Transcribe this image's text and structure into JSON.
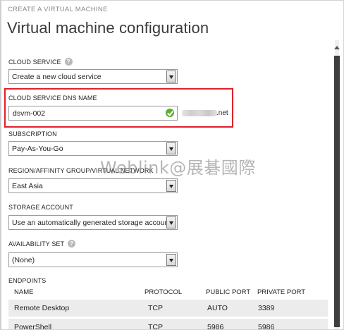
{
  "breadcrumb": "CREATE A VIRTUAL MACHINE",
  "page_title": "Virtual machine configuration",
  "cloud_service": {
    "label": "CLOUD SERVICE",
    "value": "Create a new cloud service"
  },
  "dns_name": {
    "label": "CLOUD SERVICE DNS NAME",
    "value": "dsvm-002",
    "suffix": ".net"
  },
  "subscription": {
    "label": "SUBSCRIPTION",
    "value": "Pay-As-You-Go"
  },
  "region": {
    "label": "REGION/AFFINITY GROUP/VIRTUAL NETWORK",
    "value": "East Asia"
  },
  "storage": {
    "label": "STORAGE ACCOUNT",
    "value": "Use an automatically generated storage account"
  },
  "availability": {
    "label": "AVAILABILITY SET",
    "value": "(None)"
  },
  "watermark": "Weblink@展碁國際",
  "endpoints": {
    "label": "ENDPOINTS",
    "columns": [
      "NAME",
      "PROTOCOL",
      "PUBLIC PORT",
      "PRIVATE PORT"
    ],
    "rows": [
      {
        "name": "Remote Desktop",
        "protocol": "TCP",
        "public": "AUTO",
        "private": "3389"
      },
      {
        "name": "PowerShell",
        "protocol": "TCP",
        "public": "5986",
        "private": "5986"
      }
    ]
  },
  "colors": {
    "highlight": "#e0202a",
    "valid": "#5fae2e",
    "scroll_thumb": "#3e3e3e"
  },
  "icons": [
    "help-icon",
    "checkmark-icon",
    "dropdown-arrow-icon"
  ]
}
